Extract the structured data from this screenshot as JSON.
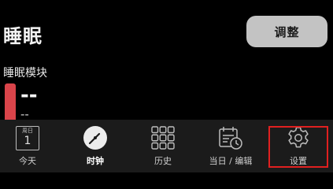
{
  "header": {
    "title": "睡眠",
    "adjust_button": "调整"
  },
  "module": {
    "section_title": "睡眠模块",
    "value_main": "--",
    "value_sub": "--",
    "accent_color": "#d9444a"
  },
  "tabbar": {
    "tabs": [
      {
        "label": "今天",
        "icon": "calendar-icon",
        "calendar_header": "周日",
        "calendar_day": "1",
        "active": false
      },
      {
        "label": "时钟",
        "icon": "clock-icon",
        "active": true
      },
      {
        "label": "历史",
        "icon": "grid-icon",
        "active": false
      },
      {
        "label": "当日 / 编辑",
        "icon": "calendar-clock-icon",
        "active": false
      },
      {
        "label": "设置",
        "icon": "gear-icon",
        "active": false,
        "highlighted": true
      }
    ]
  },
  "colors": {
    "background": "#000000",
    "tabbar_bg": "#1b1b1b",
    "highlight": "#e02020"
  }
}
